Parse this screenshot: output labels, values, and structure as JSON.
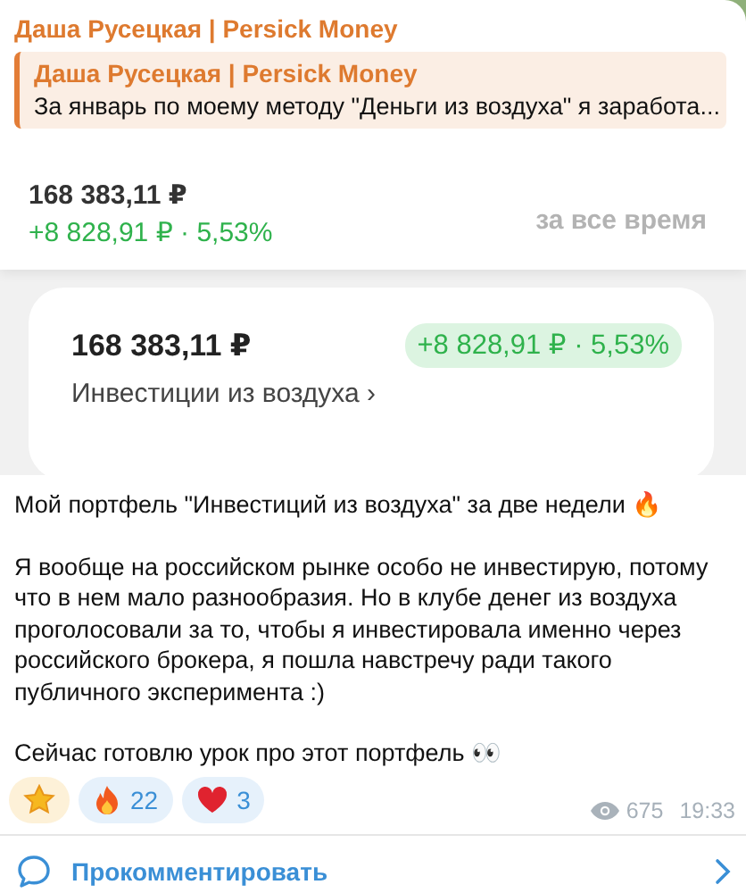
{
  "channel": {
    "author": "Даша Русецкая | Persick Money"
  },
  "reply": {
    "author": "Даша Русецкая | Persick Money",
    "text": "За январь по моему методу \"Деньги из воздуха\" я заработа..."
  },
  "screenshot": {
    "balance": "168 383,11 ₽",
    "change": "+8 828,91 ₽ · 5,53%",
    "period": "за все время",
    "card": {
      "balance": "168 383,11 ₽",
      "change": "+8 828,91 ₽ · 5,53%",
      "portfolio": "Инвестиции из воздуха ›"
    }
  },
  "paragraphs": [
    "Мой портфель \"Инвестиций из воздуха\" за две недели 🔥",
    "Я вообще на российском рынке особо не инвестирую, потому что в нем мало разнообразия. Но в клубе денег из воздуха проголосовали за то, чтобы я инвестировала именно через российского брокера, я пошла навстречу ради такого публичного эксперимента :)",
    "Сейчас готовлю урок про этот портфель 👀"
  ],
  "reactions": [
    {
      "kind": "star"
    },
    {
      "kind": "fire",
      "count": "22"
    },
    {
      "kind": "heart",
      "count": "3"
    }
  ],
  "views": "675",
  "time": "19:33",
  "comment": {
    "label": "Прокомментировать"
  }
}
